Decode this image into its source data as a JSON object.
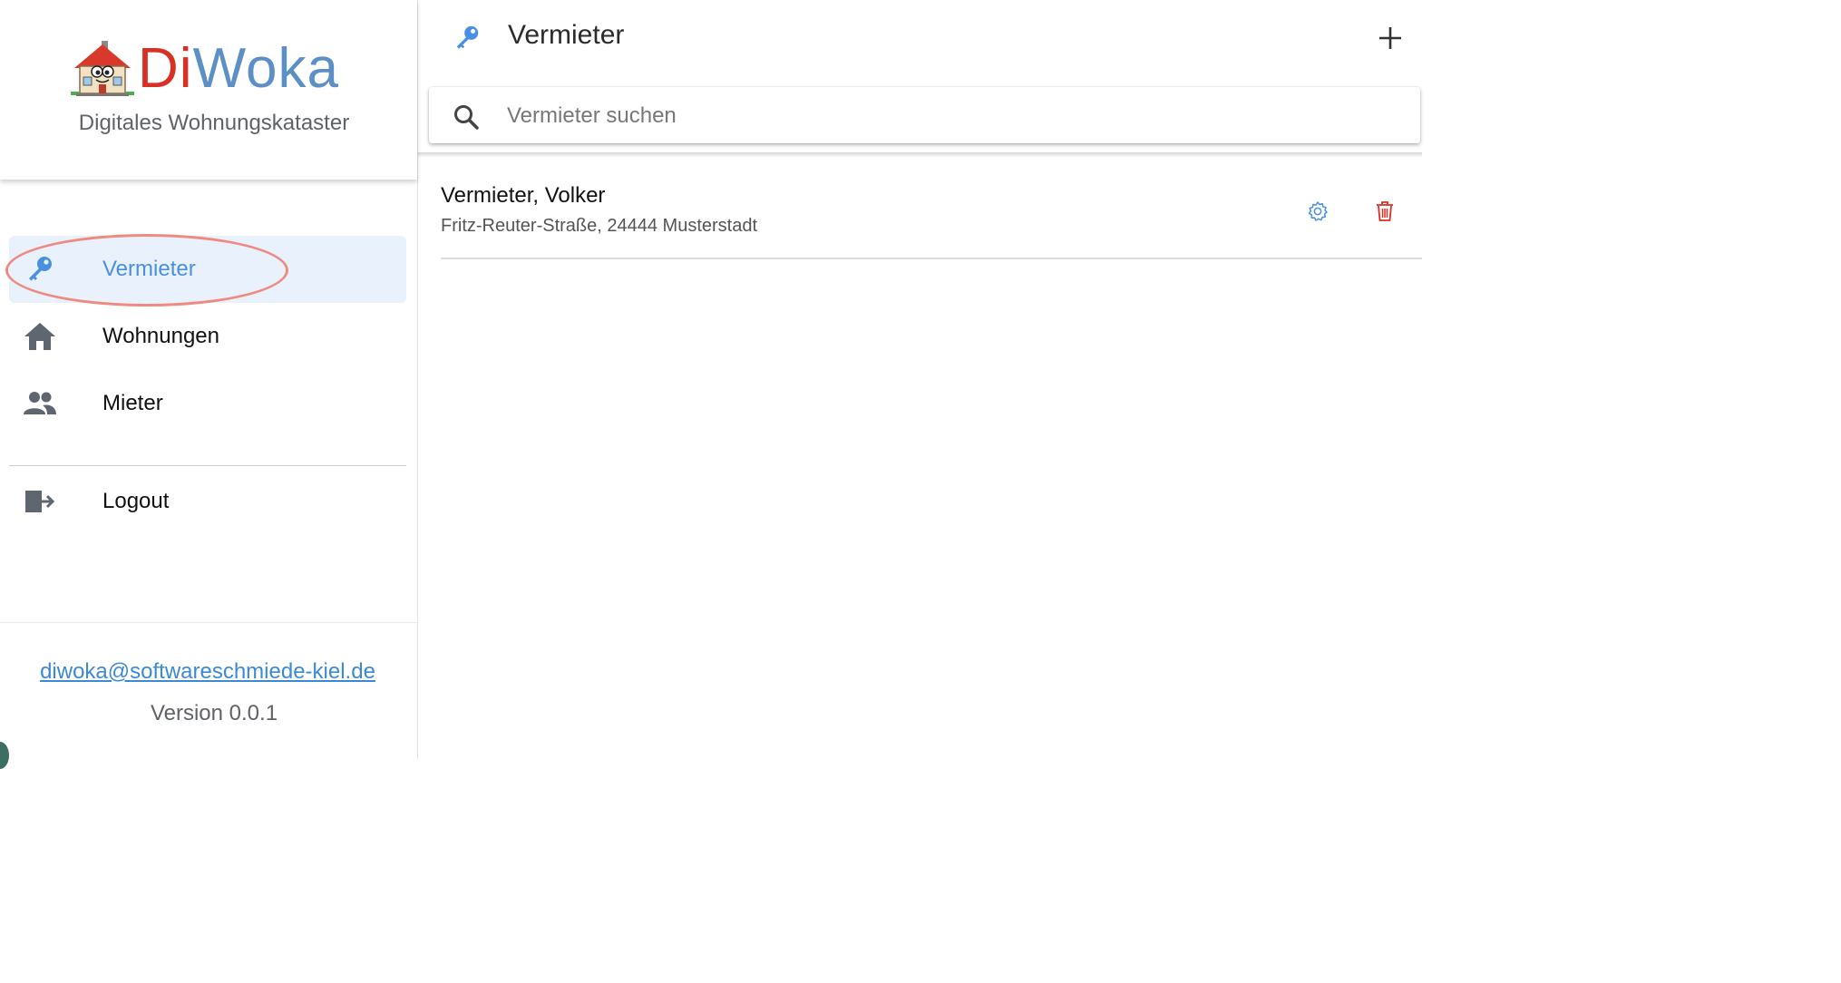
{
  "brand": {
    "logo_di": "Di",
    "logo_woka": "Woka",
    "tagline": "Digitales Wohnungskataster"
  },
  "sidebar": {
    "items": [
      {
        "label": "Vermieter",
        "icon": "key-icon",
        "active": true
      },
      {
        "label": "Wohnungen",
        "icon": "home-icon",
        "active": false
      },
      {
        "label": "Mieter",
        "icon": "people-icon",
        "active": false
      }
    ],
    "logout": {
      "label": "Logout",
      "icon": "logout-icon"
    },
    "footer": {
      "email": "diwoka@softwareschmiede-kiel.de",
      "version": "Version 0.0.1"
    }
  },
  "header": {
    "title": "Vermieter",
    "icon": "key-icon",
    "add_icon": "plus-icon"
  },
  "search": {
    "placeholder": "Vermieter suchen",
    "value": ""
  },
  "list": {
    "items": [
      {
        "name": "Vermieter, Volker",
        "address": "Fritz-Reuter-Straße, 24444 Musterstadt"
      }
    ]
  },
  "colors": {
    "accent": "#4a90e2",
    "active_bg": "#e8f1fc",
    "delete": "#d93025",
    "logo_red": "#d93025",
    "logo_blue": "#5b8fc5",
    "highlight_ring": "#ee8a80"
  }
}
